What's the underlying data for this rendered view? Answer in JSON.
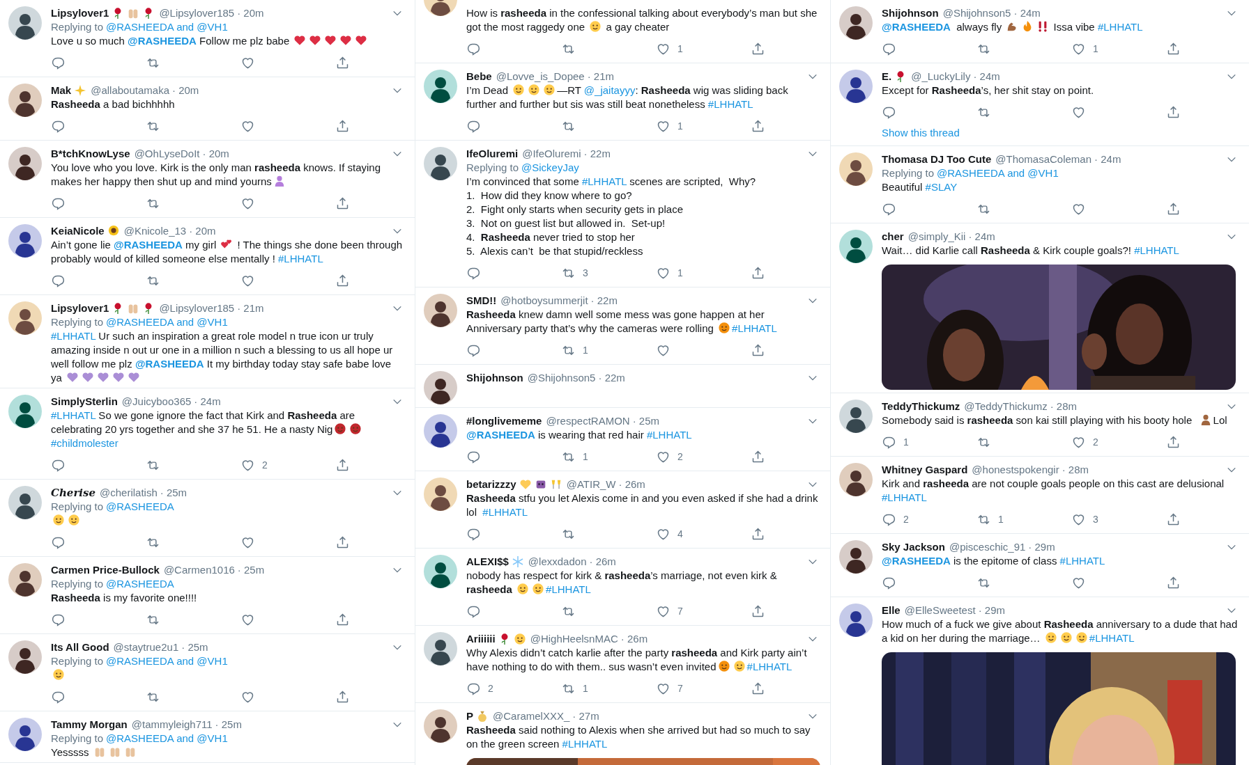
{
  "columns": [
    {
      "tweets": [
        {
          "name": "Lipsylover1",
          "name_emojis": [
            {
              "kind": "rose"
            },
            {
              "kind": "hands"
            },
            {
              "kind": "rose"
            }
          ],
          "handle": "@Lipsylover185",
          "time": "· 20m",
          "reply_label": "Replying to",
          "reply_to": "@RASHEEDA and @VH1",
          "body": [
            {
              "kind": "text",
              "text": "Love u so much "
            },
            {
              "kind": "mention",
              "text": "@RASHEEDA"
            },
            {
              "kind": "text",
              "text": " Follow me plz babe "
            },
            {
              "kind": "heart",
              "color": "#dd2e44"
            },
            {
              "kind": "heart",
              "color": "#dd2e44"
            },
            {
              "kind": "heart",
              "color": "#dd2e44"
            },
            {
              "kind": "heart",
              "color": "#dd2e44"
            },
            {
              "kind": "heart",
              "color": "#dd2e44"
            }
          ],
          "actions": true
        },
        {
          "name": "Mak",
          "name_emojis": [
            {
              "kind": "sparkles"
            }
          ],
          "handle": "@allaboutamaka",
          "time": "· 20m",
          "body": [
            {
              "kind": "text",
              "text": "**Rasheeda** a bad bichhhhh"
            }
          ],
          "actions": true
        },
        {
          "name": "B*tchKnowLyse",
          "handle": "@OhLyseDoIt",
          "time": "· 20m",
          "body": [
            {
              "kind": "text",
              "text": "You love who you love. Kirk is the only man **rasheeda** knows. If staying makes her happy then shut up and mind yourns"
            },
            {
              "kind": "person",
              "color": "#b57edc"
            }
          ],
          "actions": true
        },
        {
          "name": "KeiaNicole",
          "name_emojis": [
            {
              "kind": "sunflower"
            }
          ],
          "handle": "@Knicole_13",
          "time": "· 20m",
          "body": [
            {
              "kind": "text",
              "text": "Ain’t gone lie "
            },
            {
              "kind": "mention",
              "text": "@RASHEEDA"
            },
            {
              "kind": "text",
              "text": " my girl "
            },
            {
              "kind": "twohearts"
            },
            {
              "kind": "text",
              "text": " ! The things she done been through probably would of killed someone else mentally ! "
            },
            {
              "kind": "link",
              "text": "#LHHATL"
            }
          ],
          "actions": true
        },
        {
          "name": "Lipsylover1",
          "name_emojis": [
            {
              "kind": "rose"
            },
            {
              "kind": "hands"
            },
            {
              "kind": "rose"
            }
          ],
          "handle": "@Lipsylover185",
          "time": "· 21m",
          "reply_label": "Replying to",
          "reply_to": "@RASHEEDA and @VH1",
          "body": [
            {
              "kind": "link",
              "text": "#LHHATL"
            },
            {
              "kind": "text",
              "text": " Ur such an inspiration a great role model n true icon ur truly amazing inside n out ur one in a million n such a blessing to us all hope ur well follow me plz "
            },
            {
              "kind": "mention",
              "text": "@RASHEEDA"
            },
            {
              "kind": "text",
              "text": " It my birthday today stay safe babe love ya "
            },
            {
              "kind": "heart",
              "color": "#aa8ed6"
            },
            {
              "kind": "heart",
              "color": "#aa8ed6"
            },
            {
              "kind": "heart",
              "color": "#aa8ed6"
            },
            {
              "kind": "heart",
              "color": "#aa8ed6"
            },
            {
              "kind": "heart",
              "color": "#aa8ed6"
            }
          ]
        },
        {
          "name": "SimplySterlin",
          "handle": "@Juicyboo365",
          "time": "· 24m",
          "body": [
            {
              "kind": "link",
              "text": "#LHHATL"
            },
            {
              "kind": "text",
              "text": " So we gone ignore the fact that Kirk and **Rasheeda** are celebrating 20 yrs together and she 37 he 51. He a nasty Nig"
            },
            {
              "kind": "face",
              "color": "#c1272d"
            },
            {
              "kind": "face",
              "color": "#c1272d"
            },
            {
              "kind": "break"
            },
            {
              "kind": "link",
              "text": "#childmolester"
            }
          ],
          "actions": true,
          "like_count": "2"
        },
        {
          "name": "Cherise",
          "name_italic": true,
          "handle": "@cherilatish",
          "time": "· 25m",
          "reply_label": "Replying to",
          "reply_to": "@RASHEEDA",
          "body": [
            {
              "kind": "face",
              "color": "#ffcc4d"
            },
            {
              "kind": "face",
              "color": "#ffcc4d"
            }
          ],
          "actions": true
        },
        {
          "name": "Carmen Price-Bullock",
          "handle": "@Carmen1016",
          "time": "· 25m",
          "reply_label": "Replying to",
          "reply_to": "@RASHEEDA",
          "body": [
            {
              "kind": "text",
              "text": "**Rasheeda** is my favorite one!!!!"
            }
          ],
          "actions": true
        },
        {
          "name": "Its All Good",
          "handle": "@staytrue2u1",
          "time": "· 25m",
          "reply_label": "Replying to",
          "reply_to": "@RASHEEDA and @VH1",
          "body": [
            {
              "kind": "face",
              "color": "#ffcc4d"
            }
          ],
          "actions": true
        },
        {
          "name": "Tammy Morgan",
          "handle": "@tammyleigh711",
          "time": "· 25m",
          "reply_label": "Replying to",
          "reply_to": "@RASHEEDA and @VH1",
          "body": [
            {
              "kind": "text",
              "text": "Yesssss "
            },
            {
              "kind": "hands"
            },
            {
              "kind": "hands"
            },
            {
              "kind": "hands"
            }
          ]
        }
      ]
    },
    {
      "tweets": [
        {
          "body": [
            {
              "kind": "text",
              "text": "How is **rasheeda** in the confessional talking about everybody’s man but she got the most raggedy one "
            },
            {
              "kind": "face",
              "color": "#ffcc4d"
            },
            {
              "kind": "text",
              "text": " a gay cheater"
            }
          ],
          "actions": true,
          "like_count": "1"
        },
        {
          "name": "Bebe",
          "handle": "@Lovve_is_Dopee",
          "time": "· 21m",
          "body": [
            {
              "kind": "text",
              "text": "I’m Dead "
            },
            {
              "kind": "face",
              "color": "#ffcc4d"
            },
            {
              "kind": "face",
              "color": "#ffcc4d"
            },
            {
              "kind": "face",
              "color": "#ffcc4d"
            },
            {
              "kind": "text",
              "text": "—RT "
            },
            {
              "kind": "link",
              "text": "@_jaitayyy"
            },
            {
              "kind": "text",
              "text": ": **Rasheeda** wig was sliding back further and further but sis was still beat nonetheless "
            },
            {
              "kind": "link",
              "text": "#LHHATL"
            }
          ],
          "actions": true,
          "like_count": "1"
        },
        {
          "name": "IfeOluremi",
          "handle": "@IfeOluremi",
          "time": "· 22m",
          "reply_label": "Replying to",
          "reply_to": "@SickeyJay",
          "body": [
            {
              "kind": "text",
              "text": "I’m convinced that some "
            },
            {
              "kind": "link",
              "text": "#LHHATL"
            },
            {
              "kind": "text",
              "text": " scenes are scripted,  Why?"
            },
            {
              "kind": "break"
            },
            {
              "kind": "text",
              "text": "1.  How did they know where to go?"
            },
            {
              "kind": "break"
            },
            {
              "kind": "text",
              "text": "2.  Fight only starts when security gets in place"
            },
            {
              "kind": "break"
            },
            {
              "kind": "text",
              "text": "3.  Not on guest list but allowed in.  Set-up!"
            },
            {
              "kind": "break"
            },
            {
              "kind": "text",
              "text": "4.  **Rasheeda** never tried to stop her"
            },
            {
              "kind": "break"
            },
            {
              "kind": "text",
              "text": "5.  Alexis can’t  be that stupid/reckless"
            }
          ],
          "actions": true,
          "retweet_count": "3",
          "like_count": "1"
        },
        {
          "name": "SMD!!",
          "handle": "@hotboysummerjit",
          "time": "· 22m",
          "body": [
            {
              "kind": "text",
              "text": "**Rasheeda** knew damn well some mess was gone happen at her Anniversary party that’s why the cameras were rolling "
            },
            {
              "kind": "face",
              "color": "#f4900c"
            },
            {
              "kind": "link",
              "text": "#LHHATL"
            }
          ],
          "actions": true,
          "retweet_count": "1"
        },
        {
          "name": "Shijohnson",
          "handle": "@Shijohnson5",
          "time": "· 22m"
        },
        {
          "name": "#longlivememe",
          "handle": "@respectRAMON",
          "time": "· 25m",
          "body": [
            {
              "kind": "mention",
              "text": "@RASHEEDA"
            },
            {
              "kind": "text",
              "text": " is wearing that red hair "
            },
            {
              "kind": "link",
              "text": "#LHHATL"
            }
          ],
          "actions": true,
          "retweet_count": "1",
          "like_count": "2"
        },
        {
          "name": "betarizzzy",
          "name_emojis": [
            {
              "kind": "heart",
              "color": "#fdcb58"
            },
            {
              "kind": "monster"
            },
            {
              "kind": "champagne"
            }
          ],
          "handle": "@ATIR_W",
          "time": "· 26m",
          "body": [
            {
              "kind": "text",
              "text": "**Rasheeda** stfu you let Alexis come in and you even asked if she had a drink lol  "
            },
            {
              "kind": "link",
              "text": "#LHHATL"
            }
          ],
          "actions": true,
          "like_count": "4"
        },
        {
          "name": "ALEXI$$",
          "name_emojis": [
            {
              "kind": "snowflake"
            }
          ],
          "handle": "@lexxdadon",
          "time": "· 26m",
          "body": [
            {
              "kind": "text",
              "text": "nobody has respect for kirk & **rasheeda**’s marriage, not even kirk & **rasheeda** "
            },
            {
              "kind": "face",
              "color": "#ffcc4d"
            },
            {
              "kind": "face",
              "color": "#ffcc4d"
            },
            {
              "kind": "link",
              "text": "#LHHATL"
            }
          ],
          "actions": true,
          "like_count": "7"
        },
        {
          "name": "Ariiiiii",
          "name_emojis": [
            {
              "kind": "rose"
            },
            {
              "kind": "face",
              "color": "#ffcc4d"
            }
          ],
          "handle": "@HighHeelsnMAC",
          "time": "· 26m",
          "body": [
            {
              "kind": "text",
              "text": "Why Alexis didn’t catch karlie after the party **rasheeda** and Kirk party ain’t have nothing to do with them.. sus wasn’t even invited"
            },
            {
              "kind": "face",
              "color": "#f4900c"
            },
            {
              "kind": "face",
              "color": "#ffcc4d"
            },
            {
              "kind": "link",
              "text": "#LHHATL"
            }
          ],
          "actions": true,
          "reply_count": "2",
          "retweet_count": "1",
          "like_count": "7"
        },
        {
          "name": "P",
          "name_emojis": [
            {
              "kind": "moneybag"
            }
          ],
          "handle": "@CaramelXXX_",
          "time": "· 27m",
          "body": [
            {
              "kind": "text",
              "text": "**Rasheeda** said nothing to Alexis when she arrived but had so much to say on the green screen "
            },
            {
              "kind": "link",
              "text": "#LHHATL"
            }
          ],
          "media": {
            "kind": "picture"
          }
        }
      ]
    },
    {
      "tweets": [
        {
          "name": "Shijohnson",
          "handle": "@Shijohnson5",
          "time": "· 24m",
          "body": [
            {
              "kind": "mention",
              "text": "@RASHEEDA"
            },
            {
              "kind": "text",
              "text": "  always fly "
            },
            {
              "kind": "muscle"
            },
            {
              "kind": "fire"
            },
            {
              "kind": "bangbang"
            },
            {
              "kind": "text",
              "text": " Issa vibe "
            },
            {
              "kind": "link",
              "text": "#LHHATL"
            }
          ],
          "actions": true,
          "like_count": "1"
        },
        {
          "name": "E.",
          "name_emojis": [
            {
              "kind": "rose"
            }
          ],
          "handle": "@_LuckyLily",
          "time": "· 24m",
          "body": [
            {
              "kind": "text",
              "text": "Except for **Rasheeda**’s, her shit stay on point."
            }
          ],
          "actions": true,
          "thread_link": "Show this thread"
        },
        {
          "name": "Thomasa DJ Too Cute",
          "handle": "@ThomasaColeman",
          "time": "· 24m",
          "reply_label": "Replying to",
          "reply_to": "@RASHEEDA and @VH1",
          "body": [
            {
              "kind": "text",
              "text": "Beautiful "
            },
            {
              "kind": "link",
              "text": "#SLAY"
            }
          ],
          "actions": true
        },
        {
          "name": "cher",
          "handle": "@simply_Kii",
          "time": "· 24m",
          "body": [
            {
              "kind": "text",
              "text": "Wait… did Karlie call **Rasheeda** & Kirk couple goals?! "
            },
            {
              "kind": "link",
              "text": "#LHHATL"
            }
          ],
          "media": {
            "kind": "picture"
          }
        },
        {
          "name": "TeddyThickumz",
          "handle": "@TeddyThickumz",
          "time": "· 28m",
          "body": [
            {
              "kind": "text",
              "text": "Somebody said is **rasheeda** son kai still playing with his booty hole  "
            },
            {
              "kind": "person",
              "color": "#a0663f"
            },
            {
              "kind": "text",
              "text": "Lol"
            }
          ],
          "actions": true,
          "reply_count": "1",
          "like_count": "2"
        },
        {
          "name": "Whitney Gaspard",
          "handle": "@honestspokengir",
          "time": "· 28m",
          "body": [
            {
              "kind": "text",
              "text": "Kirk and **rasheeda** are not couple goals people on this cast are delusional "
            },
            {
              "kind": "link",
              "text": "#LHHATL"
            }
          ],
          "actions": true,
          "reply_count": "2",
          "retweet_count": "1",
          "like_count": "3"
        },
        {
          "name": "Sky Jackson",
          "handle": "@pisceschic_91",
          "time": "· 29m",
          "body": [
            {
              "kind": "mention",
              "text": "@RASHEEDA"
            },
            {
              "kind": "text",
              "text": " is the epitome of class "
            },
            {
              "kind": "link",
              "text": "#LHHATL"
            }
          ],
          "actions": true
        },
        {
          "name": "Elle",
          "handle": "@ElleSweetest",
          "time": "· 29m",
          "body": [
            {
              "kind": "text",
              "text": "How much of a fuck we give about **Rasheeda** anniversary to a dude that had a kid on her during the marriage… "
            },
            {
              "kind": "face",
              "color": "#ffcc4d"
            },
            {
              "kind": "face",
              "color": "#ffcc4d"
            },
            {
              "kind": "face",
              "color": "#ffcc4d"
            },
            {
              "kind": "link",
              "text": "#LHHATL"
            }
          ],
          "media": {
            "kind": "picture"
          }
        }
      ]
    }
  ]
}
